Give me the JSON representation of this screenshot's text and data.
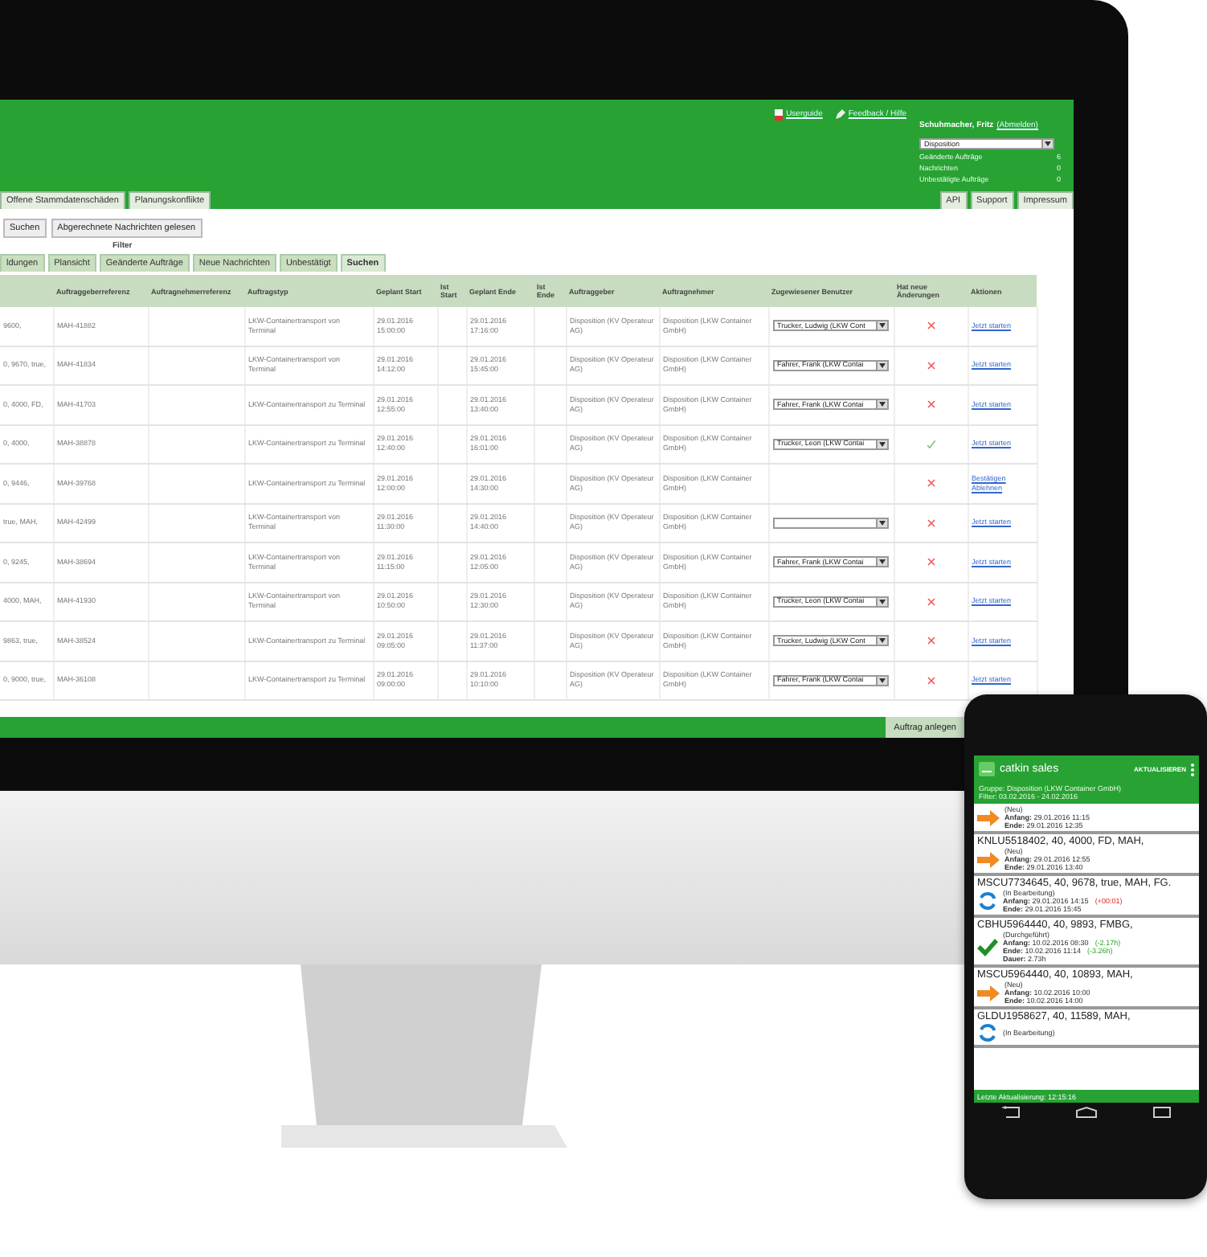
{
  "header": {
    "links": [
      {
        "kind": "pdf",
        "label": "Userguide"
      },
      {
        "kind": "pencil",
        "label": "Feedback / Hilfe"
      }
    ],
    "user": {
      "name": "Schuhmacher, Fritz",
      "logout": "(Abmelden)"
    },
    "role_select": {
      "value": "Disposition"
    },
    "counters": [
      {
        "label": "Geänderte Aufträge",
        "value": "6"
      },
      {
        "label": "Nachrichten",
        "value": "0"
      },
      {
        "label": "Unbestätigte Aufträge",
        "value": "0"
      }
    ],
    "tabs_left": [
      {
        "label": "Offene Stammdatenschäden",
        "selected": false
      },
      {
        "label": "Planungskonflikte",
        "selected": false
      }
    ],
    "tabs_right": [
      {
        "label": "API",
        "selected": false
      },
      {
        "label": "Support",
        "selected": false
      },
      {
        "label": "Impressum",
        "selected": false
      }
    ]
  },
  "toolbar": {
    "buttons": [
      "Suchen",
      "Abgerechnete Nachrichten gelesen"
    ]
  },
  "filter": {
    "title": "Filter",
    "tabs": [
      {
        "label": "ldungen",
        "selected": false
      },
      {
        "label": "Plansicht",
        "selected": false
      },
      {
        "label": "Geänderte Aufträge",
        "selected": false
      },
      {
        "label": "Neue Nachrichten",
        "selected": false
      },
      {
        "label": "Unbestätigt",
        "selected": false
      },
      {
        "label": "Suchen",
        "selected": true
      }
    ]
  },
  "table": {
    "columns": [
      "",
      "Auftraggeberreferenz",
      "Auftragnehmerreferenz",
      "Auftragstyp",
      "Geplant Start",
      "Ist Start",
      "Geplant Ende",
      "Ist Ende",
      "Auftraggeber",
      "Auftragnehmer",
      "Zugewiesener Benutzer",
      "Hat neue Änderungen",
      "Aktionen"
    ],
    "rows": [
      {
        "column_1": "9600,",
        "client_ref": "MAH-41882",
        "type": "LKW-Containertransport von Terminal",
        "planned_start": "29.01.2016 15:00:00",
        "planned_end": "29.01.2016 17:16:00",
        "client": "Disposition (KV Operateur AG)",
        "contractor": "Disposition (LKW Container GmbH)",
        "assignee": {
          "kind": "select",
          "value": "Trucker, Ludwig (LKW Cont"
        },
        "has_changes": false,
        "actions": [
          "Jetzt starten"
        ]
      },
      {
        "column_1": "0, 9670, true,",
        "client_ref": "MAH-41834",
        "type": "LKW-Containertransport von Terminal",
        "planned_start": "29.01.2016 14:12:00",
        "planned_end": "29.01.2016 15:45:00",
        "client": "Disposition (KV Operateur AG)",
        "contractor": "Disposition (LKW Container GmbH)",
        "assignee": {
          "kind": "select",
          "value": "Fahrer, Frank (LKW Contai"
        },
        "has_changes": false,
        "actions": [
          "Jetzt starten"
        ]
      },
      {
        "column_1": "0, 4000, FD,",
        "client_ref": "MAH-41703",
        "type": "LKW-Containertransport zu Terminal",
        "planned_start": "29.01.2016 12:55:00",
        "planned_end": "29.01.2016 13:40:00",
        "client": "Disposition (KV Operateur AG)",
        "contractor": "Disposition (LKW Container GmbH)",
        "assignee": {
          "kind": "select",
          "value": "Fahrer, Frank (LKW Contai"
        },
        "has_changes": false,
        "actions": [
          "Jetzt starten"
        ]
      },
      {
        "column_1": "0, 4000,",
        "client_ref": "MAH-38878",
        "type": "LKW-Containertransport zu Terminal",
        "planned_start": "29.01.2016 12:40:00",
        "planned_end": "29.01.2016 16:01:00",
        "client": "Disposition (KV Operateur AG)",
        "contractor": "Disposition (LKW Container GmbH)",
        "assignee": {
          "kind": "select",
          "value": "Trucker, Leon (LKW Contai"
        },
        "has_changes": true,
        "actions": [
          "Jetzt starten"
        ]
      },
      {
        "column_1": "0, 9446,",
        "client_ref": "MAH-39768",
        "type": "LKW-Containertransport zu Terminal",
        "planned_start": "29.01.2016 12:00:00",
        "planned_end": "29.01.2016 14:30:00",
        "client": "Disposition (KV Operateur AG)",
        "contractor": "Disposition (LKW Container GmbH)",
        "assignee": {
          "kind": "none"
        },
        "has_changes": false,
        "actions": [
          "Bestätigen",
          "Ablehnen"
        ]
      },
      {
        "column_1": "true, MAH,",
        "client_ref": "MAH-42499",
        "type": "LKW-Containertransport von Terminal",
        "planned_start": "29.01.2016 11:30:00",
        "planned_end": "29.01.2016 14:40:00",
        "client": "Disposition (KV Operateur AG)",
        "contractor": "Disposition (LKW Container GmbH)",
        "assignee": {
          "kind": "empty_select"
        },
        "has_changes": false,
        "actions": [
          "Jetzt starten"
        ]
      },
      {
        "column_1": "0, 9245,",
        "client_ref": "MAH-38694",
        "type": "LKW-Containertransport von Terminal",
        "planned_start": "29.01.2016 11:15:00",
        "planned_end": "29.01.2016 12:05:00",
        "client": "Disposition (KV Operateur AG)",
        "contractor": "Disposition (LKW Container GmbH)",
        "assignee": {
          "kind": "select",
          "value": "Fahrer, Frank (LKW Contai"
        },
        "has_changes": false,
        "actions": [
          "Jetzt starten"
        ]
      },
      {
        "column_1": "4000, MAH,",
        "client_ref": "MAH-41930",
        "type": "LKW-Containertransport von Terminal",
        "planned_start": "29.01.2016 10:50:00",
        "planned_end": "29.01.2016 12:30:00",
        "client": "Disposition (KV Operateur AG)",
        "contractor": "Disposition (LKW Container GmbH)",
        "assignee": {
          "kind": "select",
          "value": "Trucker, Leon (LKW Contai"
        },
        "has_changes": false,
        "actions": [
          "Jetzt starten"
        ]
      },
      {
        "column_1": "9863, true,",
        "client_ref": "MAH-38524",
        "type": "LKW-Containertransport zu Terminal",
        "planned_start": "29.01.2016 09:05:00",
        "planned_end": "29.01.2016 11:37:00",
        "client": "Disposition (KV Operateur AG)",
        "contractor": "Disposition (LKW Container GmbH)",
        "assignee": {
          "kind": "select",
          "value": "Trucker, Ludwig (LKW Cont"
        },
        "has_changes": false,
        "actions": [
          "Jetzt starten"
        ]
      },
      {
        "column_1": "0, 9000, true,",
        "client_ref": "MAH-36108",
        "type": "LKW-Containertransport zu Terminal",
        "planned_start": "29.01.2016 09:00:00",
        "planned_end": "29.01.2016 10:10:00",
        "client": "Disposition (KV Operateur AG)",
        "contractor": "Disposition (LKW Container GmbH)",
        "assignee": {
          "kind": "select",
          "value": "Fahrer, Frank (LKW Contai"
        },
        "has_changes": false,
        "actions": [
          "Jetzt starten"
        ]
      }
    ]
  },
  "footer": {
    "button": "Auftrag anlegen"
  },
  "phone": {
    "app_title": "catkin sales",
    "refresh_button": "AKTUALISIEREN",
    "group": {
      "label": "Gruppe:",
      "value": "Disposition (LKW Container GmbH)"
    },
    "filter": {
      "label": "Filter:",
      "value": "03.02.2016 - 24.02.2016"
    },
    "items": [
      {
        "status": "(Neu)",
        "kind": "new",
        "lines": [
          {
            "label": "Anfang:",
            "value": "29.01.2016 11:15"
          },
          {
            "label": "Ende:",
            "value": "29.01.2016 12:35"
          }
        ]
      },
      {
        "title": "KNLU5518402, 40, 4000, FD, MAH,",
        "status": "(Neu)",
        "kind": "new",
        "lines": [
          {
            "label": "Anfang:",
            "value": "29.01.2016 12:55"
          },
          {
            "label": "Ende:",
            "value": "29.01.2016 13:40"
          }
        ]
      },
      {
        "title": "MSCU7734645, 40, 9678, true, MAH, FG.",
        "status": "(In Bearbeitung)",
        "kind": "progress",
        "lines": [
          {
            "label": "Anfang:",
            "value": "29.01.2016 14:15",
            "delta": {
              "text": "(+00:01)",
              "kind": "late"
            }
          },
          {
            "label": "Ende:",
            "value": "29.01.2016 15:45"
          }
        ]
      },
      {
        "title": "CBHU5964440, 40, 9893, FMBG,",
        "status": "(Durchgeführt)",
        "kind": "done",
        "lines": [
          {
            "label": "Anfang:",
            "value": "10.02.2016 08:30",
            "delta": {
              "text": "(-2.17h)",
              "kind": "early"
            }
          },
          {
            "label": "Ende:",
            "value": "10.02.2016 11:14",
            "delta": {
              "text": "(-3.26h)",
              "kind": "early"
            }
          },
          {
            "label": "Dauer:",
            "value": "2.73h"
          }
        ]
      },
      {
        "title": "MSCU5964440, 40, 10893, MAH,",
        "status": "(Neu)",
        "kind": "new",
        "lines": [
          {
            "label": "Anfang:",
            "value": "10.02.2016 10:00"
          },
          {
            "label": "Ende:",
            "value": "10.02.2016 14:00"
          }
        ]
      },
      {
        "title": "GLDU1958627, 40, 11589, MAH,",
        "status": "(In Bearbeitung)",
        "kind": "progress"
      }
    ],
    "last_update": "Letzte Aktualisierung: 12:15:16"
  }
}
